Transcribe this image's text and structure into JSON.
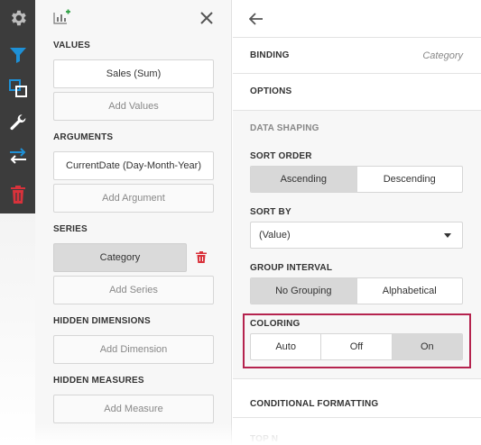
{
  "toolbar": {
    "items": [
      {
        "icon": "gear-icon"
      },
      {
        "icon": "filter-icon"
      },
      {
        "icon": "interactivity-icon"
      },
      {
        "icon": "wrench-icon"
      },
      {
        "icon": "convert-icon"
      },
      {
        "icon": "trash-icon"
      }
    ],
    "colors": {
      "background": "#3c3c3c",
      "active": "#1e90d6",
      "danger": "#d9323b"
    }
  },
  "binding_panel": {
    "values": {
      "title": "VALUES",
      "items": [
        "Sales (Sum)"
      ],
      "add_label": "Add Values"
    },
    "arguments": {
      "title": "ARGUMENTS",
      "items": [
        "CurrentDate (Day-Month-Year)"
      ],
      "add_label": "Add Argument"
    },
    "series": {
      "title": "SERIES",
      "items": [
        "Category"
      ],
      "add_label": "Add Series"
    },
    "hidden_dimensions": {
      "title": "HIDDEN DIMENSIONS",
      "add_label": "Add Dimension"
    },
    "hidden_measures": {
      "title": "HIDDEN MEASURES",
      "add_label": "Add Measure"
    }
  },
  "options_panel": {
    "binding": {
      "label": "BINDING",
      "value": "Category"
    },
    "options": {
      "label": "OPTIONS"
    },
    "data_shaping": {
      "label": "DATA SHAPING"
    },
    "sort_order": {
      "label": "SORT ORDER",
      "options": [
        "Ascending",
        "Descending"
      ],
      "selected": "Ascending"
    },
    "sort_by": {
      "label": "SORT BY",
      "value": "(Value)"
    },
    "group_interval": {
      "label": "GROUP INTERVAL",
      "options": [
        "No Grouping",
        "Alphabetical"
      ],
      "selected": "No Grouping"
    },
    "coloring": {
      "label": "COLORING",
      "options": [
        "Auto",
        "Off",
        "On"
      ],
      "selected": "On",
      "highlight_color": "#b5234e"
    },
    "conditional_formatting": {
      "label": "CONDITIONAL FORMATTING"
    },
    "top_n": {
      "label": "TOP N"
    }
  }
}
